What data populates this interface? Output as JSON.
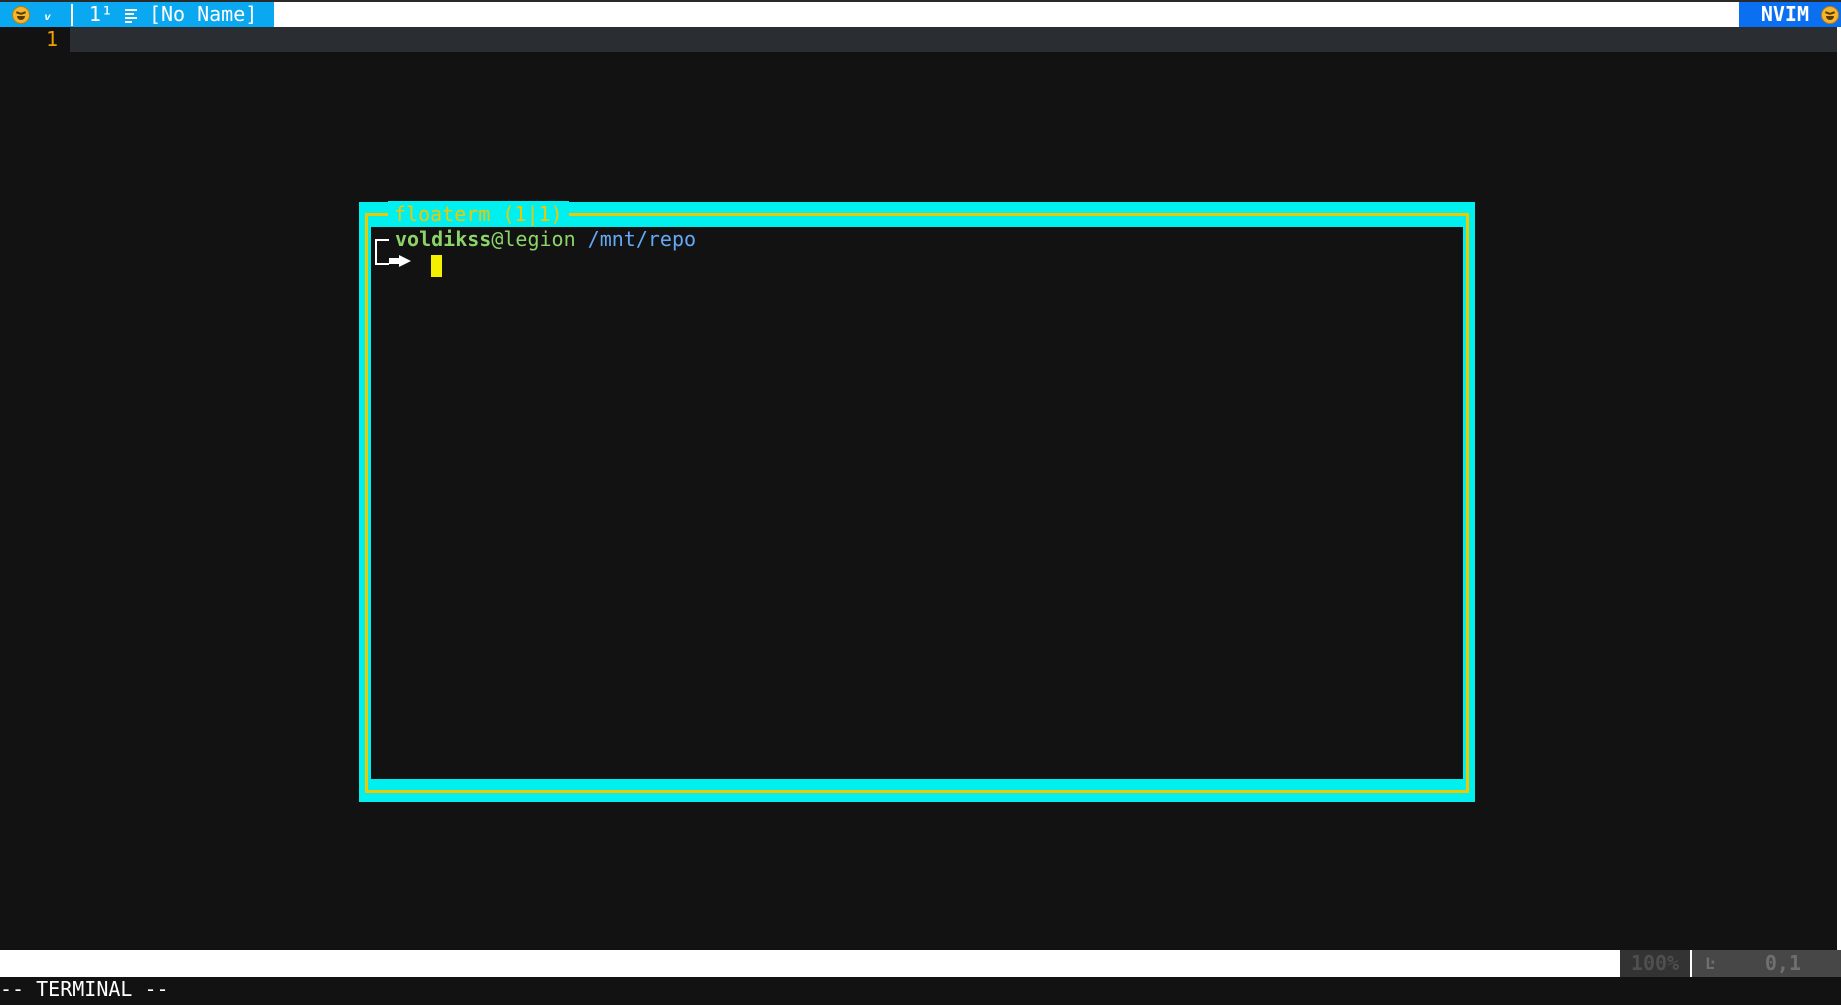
{
  "tabline": {
    "tab_number": "1¹",
    "buffer_name": "[No Name]",
    "mode_badge": "NVIM",
    "left_icon": "laughing-emoji-icon",
    "vim_icon": "vim-logo-icon",
    "list_icon": "list-icon",
    "right_icon": "laughing-emoji-icon",
    "colors": {
      "tab_bg": "#0aa8f0",
      "badge_bg": "#0a6ff0"
    }
  },
  "editor": {
    "line_number": "1",
    "colors": {
      "line_number": "#f0a000",
      "cursorline": "#2a2e33",
      "background": "#121212"
    }
  },
  "floaterm": {
    "title": "floaterm (1|1)",
    "prompt": {
      "user": "voldikss",
      "at": "@",
      "host": "legion",
      "path": "/mnt/repo"
    },
    "colors": {
      "border": "#00f0f0",
      "inner_border": "#f0c800",
      "title": "#f0c800",
      "cursor": "#f5f000"
    }
  },
  "statusline": {
    "percent": "100%",
    "line_icon": "ln-icon",
    "line_icon_glyph": "Ŀ",
    "position": "0,1"
  },
  "cmdline": {
    "mode_text": "-- TERMINAL --"
  }
}
